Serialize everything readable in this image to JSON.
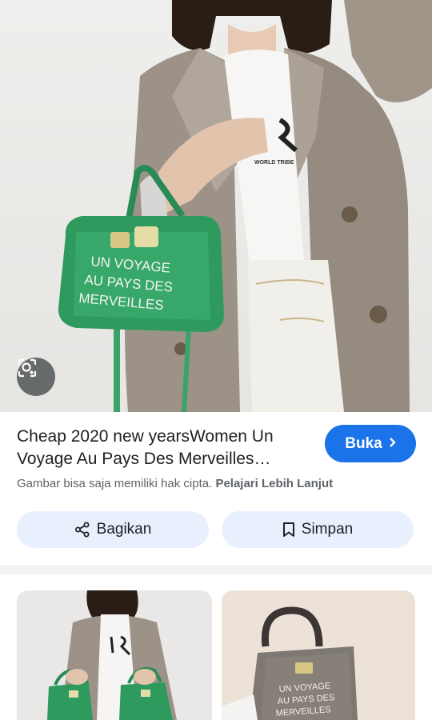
{
  "result": {
    "title": "Cheap 2020 new yearsWomen Un Voyage Au Pays Des Merveilles…",
    "visit_label": "Buka",
    "copyright_notice": "Gambar bisa saja memiliki hak cipta.",
    "learn_more_label": "Pelajari Lebih Lanjut"
  },
  "actions": {
    "share_label": "Bagikan",
    "save_label": "Simpan"
  },
  "hero": {
    "bag_text": [
      "UN VOYAGE",
      "AU PAYS DES",
      "MERVEILLES"
    ],
    "shirt_text": "WORLD TRIBE"
  },
  "related": {
    "thumb2_bag_text": [
      "UN VOYAGE",
      "AU PAYS DES",
      "MERVEILLES"
    ]
  },
  "colors": {
    "accent": "#1a73e8",
    "chip_bg": "#e8f0fe",
    "bag_green": "#2e9a5e"
  }
}
